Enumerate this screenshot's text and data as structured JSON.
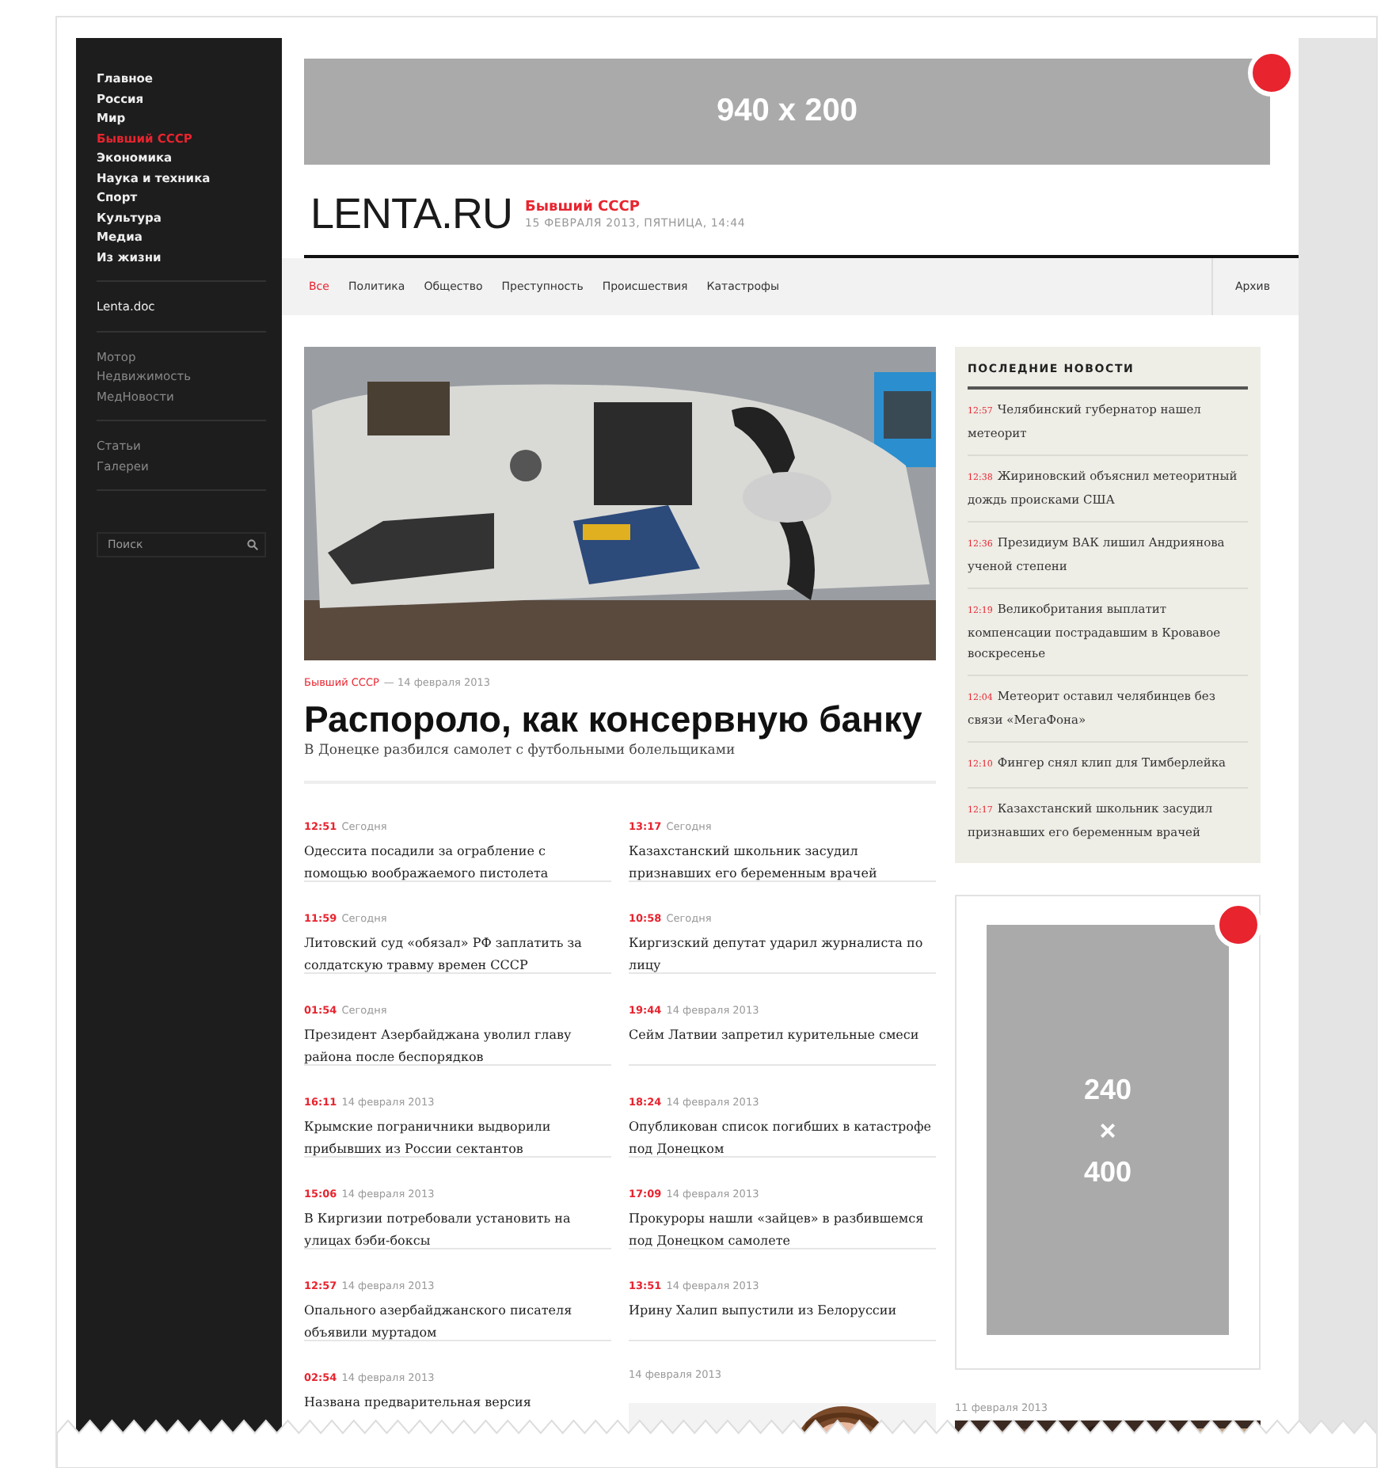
{
  "sidebar": {
    "sections": [
      {
        "kind": "main",
        "items": [
          {
            "label": "Главное",
            "selected": false
          },
          {
            "label": "Россия",
            "selected": false
          },
          {
            "label": "Мир",
            "selected": false
          },
          {
            "label": "Бывший СССР",
            "selected": true
          },
          {
            "label": "Экономика",
            "selected": false
          },
          {
            "label": "Наука и техника",
            "selected": false
          },
          {
            "label": "Спорт",
            "selected": false
          },
          {
            "label": "Культура",
            "selected": false
          },
          {
            "label": "Медиа",
            "selected": false
          },
          {
            "label": "Из жизни",
            "selected": false
          }
        ]
      },
      {
        "kind": "special",
        "items": [
          {
            "label": "Lenta.doc",
            "selected": false
          }
        ]
      },
      {
        "kind": "muted",
        "items": [
          {
            "label": "Мотор",
            "selected": false
          },
          {
            "label": "Недвижимость",
            "selected": false
          },
          {
            "label": "МедНовости",
            "selected": false
          }
        ]
      },
      {
        "kind": "muted",
        "items": [
          {
            "label": "Статьи",
            "selected": false
          },
          {
            "label": "Галереи",
            "selected": false
          }
        ]
      }
    ],
    "search": {
      "placeholder": "Поиск"
    }
  },
  "ad_banner": {
    "label": "940 x 200"
  },
  "header": {
    "logo": "LENTA.RU",
    "section": "Бывший СССР",
    "date": "15 ФЕВРАЛЯ 2013, ПЯТНИЦА, 14:44"
  },
  "nav": {
    "tabs": [
      {
        "label": "Все",
        "selected": true
      },
      {
        "label": "Политика",
        "selected": false
      },
      {
        "label": "Общество",
        "selected": false
      },
      {
        "label": "Преступность",
        "selected": false
      },
      {
        "label": "Происшествия",
        "selected": false
      },
      {
        "label": "Катастрофы",
        "selected": false
      }
    ],
    "archive": "Архив"
  },
  "lead": {
    "rubric": "Бывший СССР",
    "date": "— 14 февраля 2013",
    "title": "Распороло, как консервную банку",
    "subtitle": "В Донецке разбился самолет с футбольными болельщиками"
  },
  "news_columns": [
    [
      {
        "time": "12:51",
        "date": "Сегодня",
        "title": "Одессита посадили за ограбление с помощью воображаемого пистолета"
      },
      {
        "time": "11:59",
        "date": "Сегодня",
        "title": "Литовский суд «обязал» РФ заплатить за солдатскую травму времен СССР"
      },
      {
        "time": "01:54",
        "date": "Сегодня",
        "title": "Президент Азербайджана уволил главу района после беспорядков"
      },
      {
        "time": "16:11",
        "date": "14 февраля 2013",
        "title": "Крымские пограничники выдворили прибывших из России сектантов"
      },
      {
        "time": "15:06",
        "date": "14 февраля 2013",
        "title": "В Киргизии потребовали установить на улицах бэби-боксы"
      },
      {
        "time": "12:57",
        "date": "14 февраля 2013",
        "title": "Опального азербайджанского писателя объявили муртадом"
      },
      {
        "time": "02:54",
        "date": "14 февраля 2013",
        "title": "Названа предварительная версия"
      }
    ],
    [
      {
        "time": "13:17",
        "date": "Сегодня",
        "title": "Казахстанский школьник засудил признавших его беременным врачей"
      },
      {
        "time": "10:58",
        "date": "Сегодня",
        "title": "Киргизский депутат ударил журналиста по лицу"
      },
      {
        "time": "19:44",
        "date": "14 февраля 2013",
        "title": "Сейм Латвии запретил курительные смеси"
      },
      {
        "time": "18:24",
        "date": "14 февраля 2013",
        "title": "Опубликован список погибших в катастрофе под Донецком"
      },
      {
        "time": "17:09",
        "date": "14 февраля 2013",
        "title": "Прокуроры нашли «зайцев» в разбившемся под Донецком самолете"
      },
      {
        "time": "13:51",
        "date": "14 февраля 2013",
        "title": "Ирину Халип выпустили из Белоруссии"
      }
    ]
  ],
  "photo_story": {
    "date": "14 февраля 2013"
  },
  "latest": {
    "title": "ПОСЛЕДНИЕ НОВОСТИ",
    "items": [
      {
        "time": "12:57",
        "title": "Челябинский губернатор нашел метеорит"
      },
      {
        "time": "12:38",
        "title": "Жириновский объяснил метеоритный дождь происками США"
      },
      {
        "time": "12:36",
        "title": "Президиум ВАК лишил Андриянова ученой степени"
      },
      {
        "time": "12:19",
        "title": "Великобритания выплатит компенсации пострадавшим в Кровавое воскресенье"
      },
      {
        "time": "12:04",
        "title": "Метеорит оставил челябинцев без связи «МегаФона»"
      },
      {
        "time": "12:10",
        "title": "Фингер снял клип для Тимберлейка"
      },
      {
        "time": "12:17",
        "title": "Казахстанский школьник засудил признавших его беременным врачей"
      }
    ]
  },
  "ad_side": {
    "lines": [
      "240",
      "×",
      "400"
    ]
  },
  "side_story": {
    "date": "11 февраля 2013"
  }
}
